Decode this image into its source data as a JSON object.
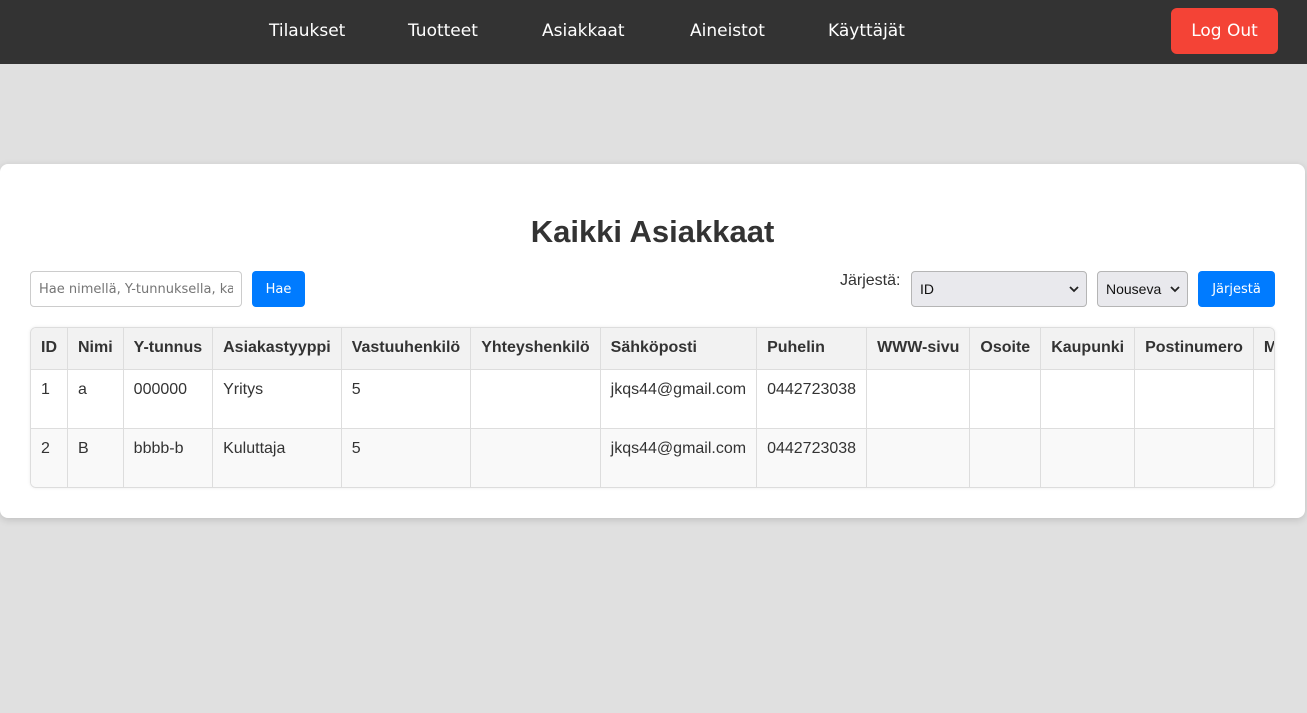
{
  "nav": {
    "items": [
      {
        "label": "Tilaukset"
      },
      {
        "label": "Tuotteet"
      },
      {
        "label": "Asiakkaat"
      },
      {
        "label": "Aineistot"
      },
      {
        "label": "Käyttäjät"
      }
    ],
    "logout_label": "Log Out"
  },
  "page": {
    "title": "Kaikki Asiakkaat"
  },
  "search": {
    "placeholder": "Hae nimellä, Y-tunnuksella, kaupungilla...",
    "value": "",
    "button_label": "Hae"
  },
  "sort": {
    "label": "Järjestä:",
    "field_selected": "ID",
    "order_selected": "Nouseva",
    "button_label": "Järjestä"
  },
  "table": {
    "headers": [
      "ID",
      "Nimi",
      "Y-tunnus",
      "Asiakastyyppi",
      "Vastuuhenkilö",
      "Yhteyshenkilö",
      "Sähköposti",
      "Puhelin",
      "WWW-sivu",
      "Osoite",
      "Kaupunki",
      "Postinumero",
      "M"
    ],
    "rows": [
      [
        "1",
        "a",
        "000000",
        "Yritys",
        "5",
        "",
        "jkqs44@gmail.com",
        "0442723038",
        "",
        "",
        "",
        "",
        ""
      ],
      [
        "2",
        "B",
        "bbbb-b",
        "Kuluttaja",
        "5",
        "",
        "jkqs44@gmail.com",
        "0442723038",
        "",
        "",
        "",
        "",
        ""
      ]
    ]
  },
  "colors": {
    "navbar_bg": "#333333",
    "logout_bg": "#f44336",
    "primary_blue": "#007bff",
    "page_bg": "#e0e0e0"
  }
}
